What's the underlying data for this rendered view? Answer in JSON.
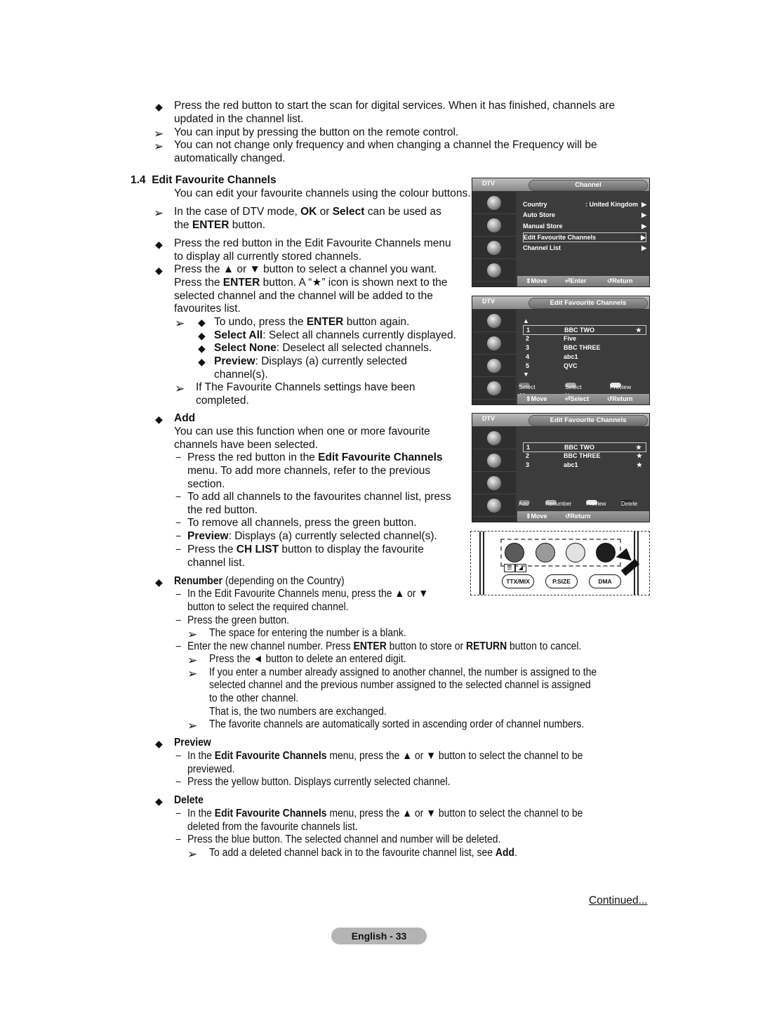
{
  "intro": {
    "bullet1": "Press the red button to start the scan for digital services. When it has finished, channels are",
    "bullet1_cont": "updated in the channel list.",
    "note1": "You can input by pressing the button on the remote control.",
    "note2": "You can not change only frequency and when changing a channel the Frequency will be",
    "note2_cont": "automatically changed."
  },
  "section": {
    "number": "1.4",
    "title": "Edit Favourite Channels",
    "desc": "You can edit your favourite channels using the colour buttons.",
    "note_dtv_1a": "In the case of DTV mode, ",
    "note_dtv_ok": "OK",
    "note_dtv_or": " or ",
    "note_dtv_select": "Select",
    "note_dtv_1b": " can be used as",
    "note_dtv_2a": "the ",
    "note_dtv_enter": "ENTER",
    "note_dtv_2b": " button.",
    "b1_l1": "Press the red button in the Edit Favourite Channels menu",
    "b1_l2": "to display all currently stored channels.",
    "b2_l1": "Press the ▲ or ▼ button to select a channel you want.",
    "b2_l2a": "Press the ",
    "b2_l2_enter": "ENTER",
    "b2_l2b": " button. A “★” icon is shown next to the",
    "b2_l3": "selected channel and the channel will be added to the",
    "b2_l4": "favourites list.",
    "sub1a": "To undo, press the ",
    "sub1_enter": "ENTER",
    "sub1b": " button again.",
    "sub2_bold": "Select All",
    "sub2": ": Select all channels currently displayed.",
    "sub3_bold": "Select None",
    "sub3": ": Deselect all selected channels.",
    "sub4_bold": "Preview",
    "sub4": ": Displays (a) currently selected",
    "sub4_cont": "channel(s).",
    "note_done_1": "If The Favourite Channels settings have been",
    "note_done_2": "completed."
  },
  "add": {
    "title": "Add",
    "desc1": "You can use this function when one or more favourite",
    "desc2": "channels have been selected.",
    "d1a": "Press the red button in the ",
    "d1_bold": "Edit Favourite Channels",
    "d1_l2": "menu. To add more channels, refer to the previous",
    "d1_l3": "section.",
    "d2_l1": "To add all channels to the favourites channel list, press",
    "d2_l2": "the red button.",
    "d3": "To remove all channels, press the green button.",
    "d4_bold": "Preview",
    "d4": ": Displays (a) currently selected channel(s).",
    "d5a": "Press the ",
    "d5_bold": "CH LIST",
    "d5b": " button to display the favourite",
    "d5_l2": "channel list."
  },
  "renumber": {
    "title": "Renumber",
    "title_suffix": " (depending on the Country)",
    "d1_l1": "In the Edit Favourite Channels menu, press the ▲ or ▼",
    "d1_l2": "button to select the required channel.",
    "d2": "Press the green button.",
    "n1": "The space for entering the number is a blank.",
    "d3a": "Enter the new channel number. Press ",
    "d3_enter": "ENTER",
    "d3b": " button to store or ",
    "d3_return": "RETURN",
    "d3c": " button to cancel.",
    "n2": "Press the ◄ button to delete an entered digit.",
    "n3_l1": "If you enter a number already assigned to another channel, the number is assigned to the",
    "n3_l2": "selected channel and the previous number assigned to the selected channel is assigned",
    "n3_l3": "to the other channel.",
    "n3_l4": "That is, the two numbers are exchanged.",
    "n4": "The favorite channels are automatically sorted in ascending order of channel numbers."
  },
  "preview": {
    "title": "Preview",
    "d1a": "In the ",
    "d1_bold": "Edit Favourite Channels",
    "d1b": " menu, press the ▲ or ▼ button to select the channel to be",
    "d1_l2": "previewed.",
    "d2": "Press the yellow button. Displays currently selected channel."
  },
  "delete": {
    "title": "Delete",
    "d1a": "In the ",
    "d1_bold": "Edit Favourite Channels",
    "d1b": " menu, press the ▲ or ▼ button to select the channel to be",
    "d1_l2": "deleted from the favourite channels list.",
    "d2": "Press the blue button. The selected channel and number will be deleted.",
    "n1a": "To add a deleted channel back in to the favourite channel list, see ",
    "n1_bold": "Add",
    "n1b": "."
  },
  "footer": {
    "continued": "Continued...",
    "page": "English - 33"
  },
  "osd1": {
    "mode": "DTV",
    "title": "Channel",
    "items": [
      {
        "label": "Country",
        "value": ": United Kingdom",
        "arrow": "▶"
      },
      {
        "label": "Auto Store",
        "value": "",
        "arrow": "▶"
      },
      {
        "label": "Manual Store",
        "value": "",
        "arrow": "▶"
      },
      {
        "label": "Edit Favourite Channels",
        "value": "",
        "arrow": "▶"
      },
      {
        "label": "Channel List",
        "value": "",
        "arrow": "▶"
      }
    ],
    "footer": {
      "move": "Move",
      "enter": "Enter",
      "return": "Return"
    }
  },
  "osd2": {
    "mode": "DTV",
    "title": "Edit Favourite Channels",
    "up": "▲",
    "down": "▼",
    "channels": [
      {
        "num": "1",
        "name": "BBC TWO",
        "star": "★"
      },
      {
        "num": "2",
        "name": "Five",
        "star": ""
      },
      {
        "num": "3",
        "name": "BBC THREE",
        "star": ""
      },
      {
        "num": "4",
        "name": "abc1",
        "star": ""
      },
      {
        "num": "5",
        "name": "QVC",
        "star": ""
      }
    ],
    "colors": {
      "red": "Select All",
      "green": "Select None",
      "yellow": "Preview"
    },
    "footer": {
      "move": "Move",
      "select": "Select",
      "return": "Return"
    }
  },
  "osd3": {
    "mode": "DTV",
    "title": "Edit Favourite Channels",
    "channels": [
      {
        "num": "1",
        "name": "BBC TWO",
        "star": "★"
      },
      {
        "num": "2",
        "name": "BBC THREE",
        "star": "★"
      },
      {
        "num": "3",
        "name": "abc1",
        "star": "★"
      }
    ],
    "colors": {
      "red": "Add",
      "green": "Renumber",
      "yellow": "Preview",
      "blue": "Delete"
    },
    "footer": {
      "move": "Move",
      "return": "Return"
    }
  },
  "remote": {
    "buttons": [
      "TTX/MIX",
      "P.SIZE",
      "DMA"
    ],
    "color_keys": [
      "#5a5a5a",
      "#9a9a9a",
      "#e2e2e2",
      "#1e1e1e"
    ]
  },
  "glyphs": {
    "diamond": "◆",
    "arrow": "➢",
    "dash": "−"
  }
}
